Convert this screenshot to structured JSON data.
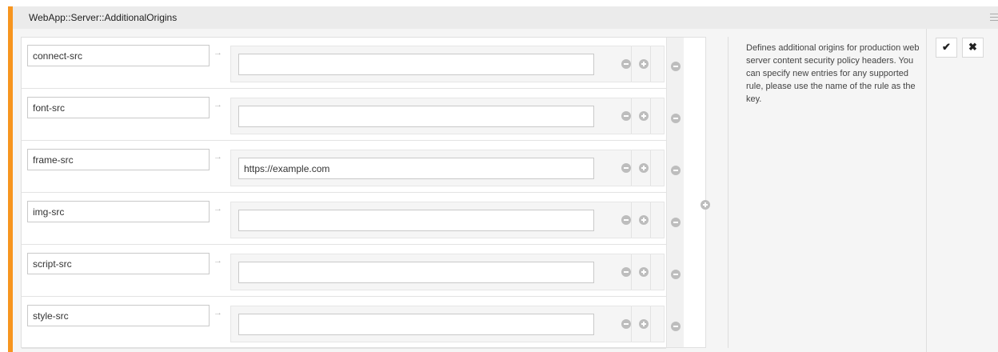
{
  "setting": {
    "title": "WebApp::Server::AdditionalOrigins",
    "description": "Defines additional origins for production web server content security policy headers. You can specify new entries for any supported rule, please use the name of the rule as the key.",
    "accent_color": "#f7951f",
    "arrow_glyph": "→",
    "entries": [
      {
        "key": "connect-src",
        "value": ""
      },
      {
        "key": "font-src",
        "value": ""
      },
      {
        "key": "frame-src",
        "value": "https://example.com"
      },
      {
        "key": "img-src",
        "value": ""
      },
      {
        "key": "script-src",
        "value": ""
      },
      {
        "key": "style-src",
        "value": ""
      }
    ],
    "actions": {
      "save_glyph": "✔",
      "cancel_glyph": "✖"
    }
  }
}
